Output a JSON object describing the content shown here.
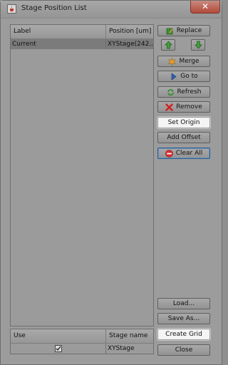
{
  "window": {
    "title": "Stage Position List"
  },
  "position_table": {
    "headers": [
      "Label",
      "Position [um]"
    ],
    "rows": [
      {
        "label": "Current",
        "position": "XYStage(242..."
      }
    ]
  },
  "stage_table": {
    "headers": [
      "Use",
      "Stage name"
    ],
    "rows": [
      {
        "use": true,
        "stage_name": "XYStage"
      }
    ]
  },
  "buttons": {
    "replace": "Replace",
    "merge": "Merge",
    "goto": "Go to",
    "refresh": "Refresh",
    "remove": "Remove",
    "set_origin": "Set Origin",
    "add_offset": "Add Offset",
    "clear_all": "Clear All",
    "load": "Load...",
    "save_as": "Save As...",
    "create_grid": "Create Grid",
    "close": "Close"
  },
  "icons": {
    "app": "java-cup-icon",
    "close": "close-icon",
    "replace": "edit-icon",
    "move_up": "arrow-up-icon",
    "move_down": "arrow-down-icon",
    "merge": "star-burst-icon",
    "goto": "play-arrow-icon",
    "refresh": "refresh-icon",
    "remove": "red-x-icon",
    "clear_all": "no-entry-icon"
  },
  "colors": {
    "window_bg": "#9c9c9c",
    "close_button": "#b24a3a",
    "selected_row": "#7b7b7b"
  }
}
